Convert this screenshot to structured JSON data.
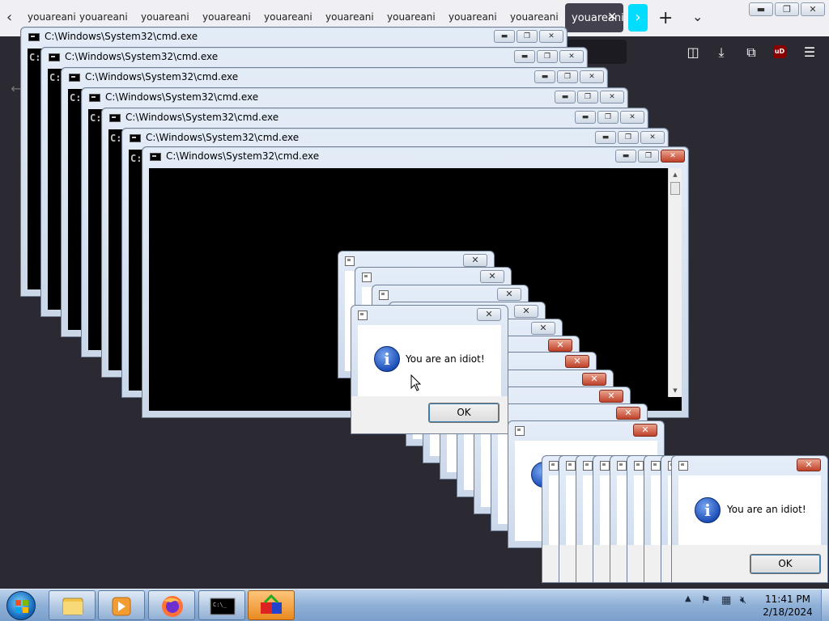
{
  "browser": {
    "tabs": [
      "youareanid",
      "youareanid",
      "youareanid",
      "youareanid",
      "youareanid",
      "youareanid",
      "youareanid",
      "youareanid",
      "youareanid"
    ],
    "active_tab": "youareanidiot",
    "icons": [
      "back-icon",
      "pocket-icon",
      "download-icon",
      "extensions-icon",
      "ublock-icon",
      "menu-icon"
    ],
    "ublock_label": "uD"
  },
  "window_controls": {
    "minimize": "▬",
    "maximize": "❐",
    "close": "✕"
  },
  "cmd": {
    "title": "C:\\Windows\\System32\\cmd.exe",
    "prompt": "C:"
  },
  "dialog": {
    "message": "You are an idiot!",
    "ok_label": "OK",
    "info_glyph": "i",
    "close_glyph": "✕"
  },
  "taskbar": {
    "time": "11:41 PM",
    "date": "2/18/2024",
    "apps": [
      "start-orb",
      "explorer",
      "media-player",
      "firefox",
      "cmd",
      "paint-app"
    ],
    "tray_icons": [
      "show-hidden-icon",
      "action-center-flag-icon",
      "network-icon",
      "volume-muted-icon"
    ]
  },
  "colors": {
    "firefox_accent": "#00ddff",
    "close_red": "#c0412a",
    "desktop": "#2b2a33"
  }
}
